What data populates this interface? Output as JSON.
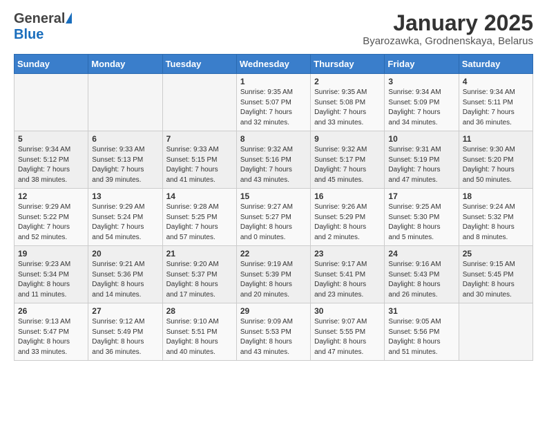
{
  "logo": {
    "general": "General",
    "blue": "Blue"
  },
  "title": "January 2025",
  "subtitle": "Byarozawka, Grodnenskaya, Belarus",
  "days_of_week": [
    "Sunday",
    "Monday",
    "Tuesday",
    "Wednesday",
    "Thursday",
    "Friday",
    "Saturday"
  ],
  "weeks": [
    [
      {
        "day": "",
        "content": ""
      },
      {
        "day": "",
        "content": ""
      },
      {
        "day": "",
        "content": ""
      },
      {
        "day": "1",
        "content": "Sunrise: 9:35 AM\nSunset: 5:07 PM\nDaylight: 7 hours\nand 32 minutes."
      },
      {
        "day": "2",
        "content": "Sunrise: 9:35 AM\nSunset: 5:08 PM\nDaylight: 7 hours\nand 33 minutes."
      },
      {
        "day": "3",
        "content": "Sunrise: 9:34 AM\nSunset: 5:09 PM\nDaylight: 7 hours\nand 34 minutes."
      },
      {
        "day": "4",
        "content": "Sunrise: 9:34 AM\nSunset: 5:11 PM\nDaylight: 7 hours\nand 36 minutes."
      }
    ],
    [
      {
        "day": "5",
        "content": "Sunrise: 9:34 AM\nSunset: 5:12 PM\nDaylight: 7 hours\nand 38 minutes."
      },
      {
        "day": "6",
        "content": "Sunrise: 9:33 AM\nSunset: 5:13 PM\nDaylight: 7 hours\nand 39 minutes."
      },
      {
        "day": "7",
        "content": "Sunrise: 9:33 AM\nSunset: 5:15 PM\nDaylight: 7 hours\nand 41 minutes."
      },
      {
        "day": "8",
        "content": "Sunrise: 9:32 AM\nSunset: 5:16 PM\nDaylight: 7 hours\nand 43 minutes."
      },
      {
        "day": "9",
        "content": "Sunrise: 9:32 AM\nSunset: 5:17 PM\nDaylight: 7 hours\nand 45 minutes."
      },
      {
        "day": "10",
        "content": "Sunrise: 9:31 AM\nSunset: 5:19 PM\nDaylight: 7 hours\nand 47 minutes."
      },
      {
        "day": "11",
        "content": "Sunrise: 9:30 AM\nSunset: 5:20 PM\nDaylight: 7 hours\nand 50 minutes."
      }
    ],
    [
      {
        "day": "12",
        "content": "Sunrise: 9:29 AM\nSunset: 5:22 PM\nDaylight: 7 hours\nand 52 minutes."
      },
      {
        "day": "13",
        "content": "Sunrise: 9:29 AM\nSunset: 5:24 PM\nDaylight: 7 hours\nand 54 minutes."
      },
      {
        "day": "14",
        "content": "Sunrise: 9:28 AM\nSunset: 5:25 PM\nDaylight: 7 hours\nand 57 minutes."
      },
      {
        "day": "15",
        "content": "Sunrise: 9:27 AM\nSunset: 5:27 PM\nDaylight: 8 hours\nand 0 minutes."
      },
      {
        "day": "16",
        "content": "Sunrise: 9:26 AM\nSunset: 5:29 PM\nDaylight: 8 hours\nand 2 minutes."
      },
      {
        "day": "17",
        "content": "Sunrise: 9:25 AM\nSunset: 5:30 PM\nDaylight: 8 hours\nand 5 minutes."
      },
      {
        "day": "18",
        "content": "Sunrise: 9:24 AM\nSunset: 5:32 PM\nDaylight: 8 hours\nand 8 minutes."
      }
    ],
    [
      {
        "day": "19",
        "content": "Sunrise: 9:23 AM\nSunset: 5:34 PM\nDaylight: 8 hours\nand 11 minutes."
      },
      {
        "day": "20",
        "content": "Sunrise: 9:21 AM\nSunset: 5:36 PM\nDaylight: 8 hours\nand 14 minutes."
      },
      {
        "day": "21",
        "content": "Sunrise: 9:20 AM\nSunset: 5:37 PM\nDaylight: 8 hours\nand 17 minutes."
      },
      {
        "day": "22",
        "content": "Sunrise: 9:19 AM\nSunset: 5:39 PM\nDaylight: 8 hours\nand 20 minutes."
      },
      {
        "day": "23",
        "content": "Sunrise: 9:17 AM\nSunset: 5:41 PM\nDaylight: 8 hours\nand 23 minutes."
      },
      {
        "day": "24",
        "content": "Sunrise: 9:16 AM\nSunset: 5:43 PM\nDaylight: 8 hours\nand 26 minutes."
      },
      {
        "day": "25",
        "content": "Sunrise: 9:15 AM\nSunset: 5:45 PM\nDaylight: 8 hours\nand 30 minutes."
      }
    ],
    [
      {
        "day": "26",
        "content": "Sunrise: 9:13 AM\nSunset: 5:47 PM\nDaylight: 8 hours\nand 33 minutes."
      },
      {
        "day": "27",
        "content": "Sunrise: 9:12 AM\nSunset: 5:49 PM\nDaylight: 8 hours\nand 36 minutes."
      },
      {
        "day": "28",
        "content": "Sunrise: 9:10 AM\nSunset: 5:51 PM\nDaylight: 8 hours\nand 40 minutes."
      },
      {
        "day": "29",
        "content": "Sunrise: 9:09 AM\nSunset: 5:53 PM\nDaylight: 8 hours\nand 43 minutes."
      },
      {
        "day": "30",
        "content": "Sunrise: 9:07 AM\nSunset: 5:55 PM\nDaylight: 8 hours\nand 47 minutes."
      },
      {
        "day": "31",
        "content": "Sunrise: 9:05 AM\nSunset: 5:56 PM\nDaylight: 8 hours\nand 51 minutes."
      },
      {
        "day": "",
        "content": ""
      }
    ]
  ]
}
